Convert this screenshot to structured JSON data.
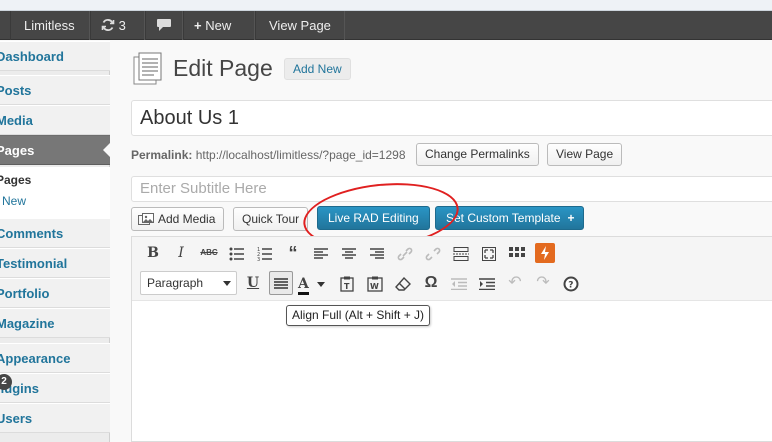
{
  "admin_bar": {
    "site": "Limitless",
    "updates_count": "3",
    "new_label": "New",
    "view_page": "View Page"
  },
  "sidebar": {
    "items": [
      {
        "label": "Dashboard"
      },
      {
        "label": "Posts"
      },
      {
        "label": "Media"
      },
      {
        "label": "Pages"
      },
      {
        "label": "Comments"
      },
      {
        "label": "Testimonial"
      },
      {
        "label": "Portfolio"
      },
      {
        "label": "Magazine"
      },
      {
        "label": "Appearance"
      },
      {
        "label": "Plugins"
      },
      {
        "label": "Users"
      }
    ],
    "pages_submenu": [
      "Pages",
      "New"
    ],
    "plugins_badge": "2"
  },
  "header": {
    "title": "Edit Page",
    "add_new": "Add New"
  },
  "post": {
    "title": "About Us 1",
    "permalink_label": "Permalink:",
    "permalink_url": "http://localhost/limitless/?page_id=1298",
    "change_permalinks": "Change Permalinks",
    "view_page": "View Page",
    "subtitle_placeholder": "Enter Subtitle Here"
  },
  "buttons": {
    "add_media": "Add Media",
    "quick_tour": "Quick Tour",
    "live_rad": "Live RAD Editing",
    "custom_template": "Set Custom Template",
    "custom_template_plus": "+"
  },
  "editor": {
    "format_select": "Paragraph",
    "tooltip": "Align Full (Alt + Shift + J)"
  },
  "colors": {
    "link": "#21759b",
    "primary_button": "#21759b",
    "admin_bar": "#464646",
    "annotation": "#e02020"
  }
}
